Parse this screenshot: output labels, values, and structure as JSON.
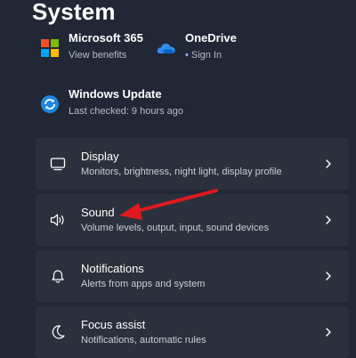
{
  "page": {
    "title": "System"
  },
  "tiles": {
    "microsoft365": {
      "name": "Microsoft 365",
      "sub": "View benefits",
      "icon": "microsoft-logo-icon"
    },
    "onedrive": {
      "name": "OneDrive",
      "dot": "•",
      "sub": "Sign In",
      "icon": "onedrive-cloud-icon"
    },
    "update": {
      "name": "Windows Update",
      "sub": "Last checked: 9 hours ago",
      "icon": "windows-update-icon"
    }
  },
  "cards": [
    {
      "title": "Display",
      "desc": "Monitors, brightness, night light, display profile",
      "icon": "display-monitor-icon"
    },
    {
      "title": "Sound",
      "desc": "Volume levels, output, input, sound devices",
      "icon": "speaker-icon"
    },
    {
      "title": "Notifications",
      "desc": "Alerts from apps and system",
      "icon": "bell-icon"
    },
    {
      "title": "Focus assist",
      "desc": "Notifications, automatic rules",
      "icon": "moon-icon"
    }
  ],
  "colors": {
    "background": "#212734",
    "card": "#2b313c",
    "annotation_arrow": "#e0191f"
  }
}
